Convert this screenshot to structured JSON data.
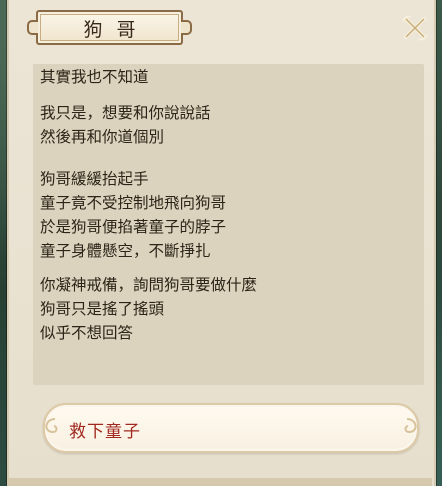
{
  "dialog": {
    "title": "狗哥",
    "close_icon": "close-x-icon",
    "lines": [
      "其實我也不知道",
      "我只是，想要和你說說話",
      "然後再和你道個別",
      "狗哥緩緩抬起手",
      "童子竟不受控制地飛向狗哥",
      "於是狗哥便掐著童子的脖子",
      "童子身體懸空，不斷掙扎",
      "你凝神戒備，詢問狗哥要做什麼",
      "狗哥只是搖了搖頭",
      "似乎不想回答"
    ]
  },
  "choice": {
    "label": "救下童子"
  },
  "colors": {
    "panel_bg": "#ece5d6",
    "text_box_bg": "#dcd3be",
    "choice_text": "#a2271f",
    "border_brown": "#8a6b45"
  }
}
